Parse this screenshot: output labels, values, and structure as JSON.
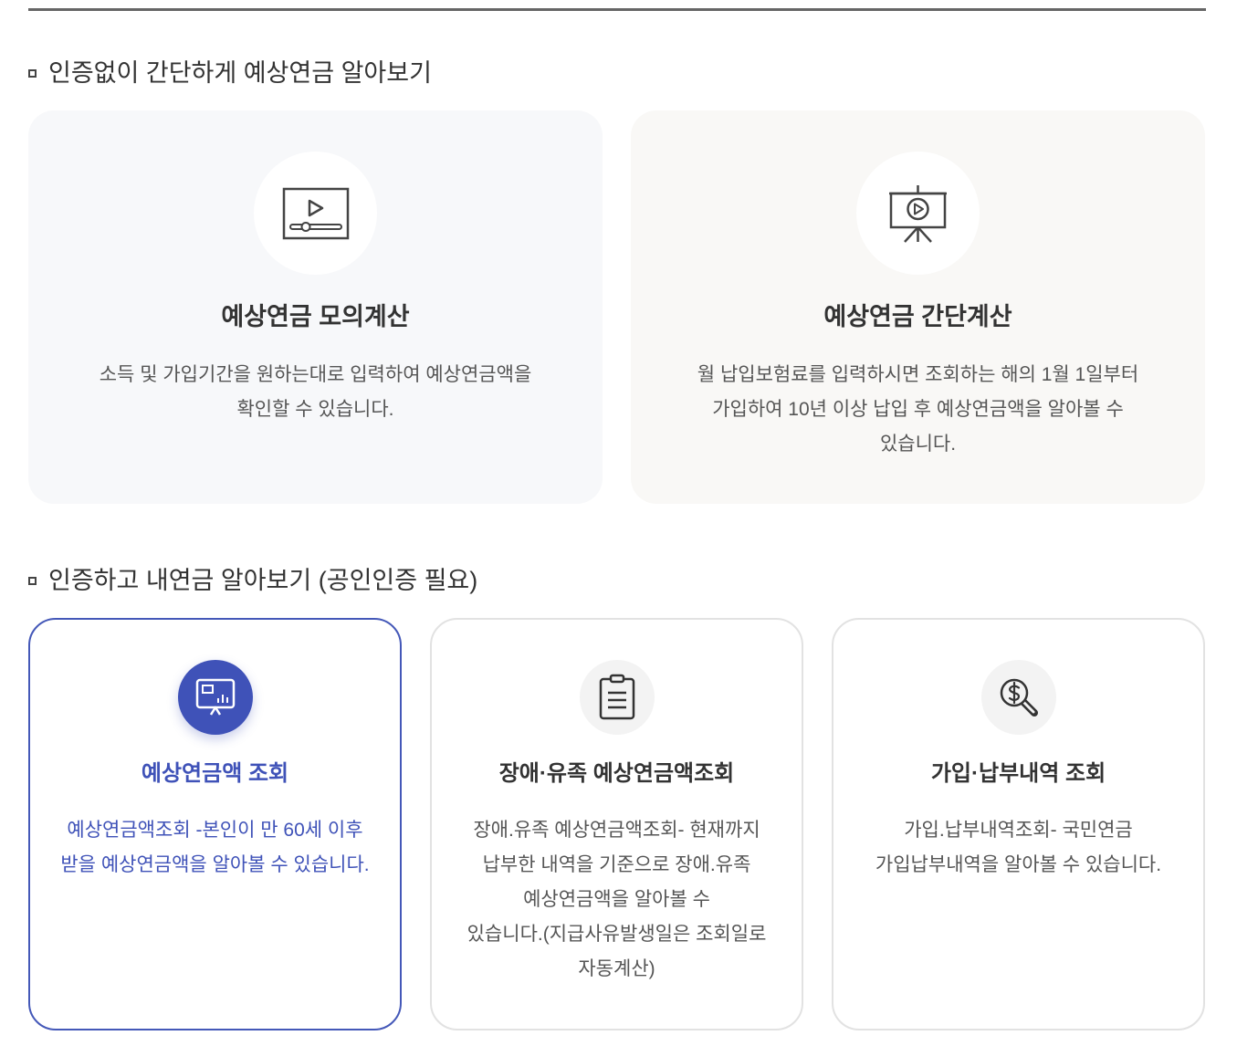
{
  "section_no_auth": {
    "title": "인증없이 간단하게 예상연금 알아보기",
    "cards": [
      {
        "icon": "video-player-icon",
        "title": "예상연금 모의계산",
        "description": "소득 및 가입기간을 원하는대로 입력하여 예상연금액을\n확인할 수 있습니다."
      },
      {
        "icon": "presentation-play-icon",
        "title": "예상연금 간단계산",
        "description": "월 납입보험료를 입력하시면 조회하는 해의 1월 1일부터\n가입하여 10년 이상 납입 후 예상연금액을 알아볼 수\n있습니다."
      }
    ]
  },
  "section_auth": {
    "title": "인증하고 내연금 알아보기 (공인인증 필요)",
    "cards": [
      {
        "icon": "monitor-chart-icon",
        "title": "예상연금액 조회",
        "description": "예상연금액조회 -본인이 만 60세 이후\n받을 예상연금액을 알아볼 수 있습니다."
      },
      {
        "icon": "clipboard-icon",
        "title": "장애·유족 예상연금액조회",
        "description": "장애.유족 예상연금액조회- 현재까지\n납부한 내역을 기준으로 장애.유족\n예상연금액을 알아볼 수\n있습니다.(지급사유발생일은 조회일로\n자동계산)"
      },
      {
        "icon": "dollar-search-icon",
        "title": "가입·납부내역 조회",
        "description": "가입.납부내역조회- 국민연금\n가입납부내역을 알아볼 수 있습니다."
      }
    ]
  },
  "colors": {
    "accent": "#3f52b8",
    "text": "#333333",
    "muted_text": "#555555",
    "card_bg_cool": "#f7f8fa",
    "card_bg_warm": "#f9f8f6",
    "card_border": "#e2e2e2",
    "icon_circle_bg": "#f3f3f3"
  }
}
